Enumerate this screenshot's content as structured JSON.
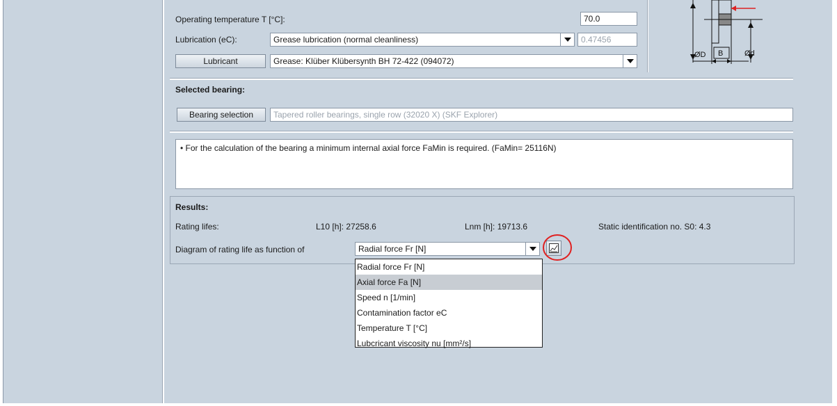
{
  "params": {
    "operating_temperature_label": "Operating temperature T [°C]:",
    "operating_temperature_value": "70.0",
    "lubrication_label": "Lubrication (eC):",
    "lubrication_value": "Grease lubrication (normal cleanliness)",
    "lubrication_ec_value": "0.47456",
    "lubricant_button": "Lubricant",
    "lubricant_value": "Grease: Klüber Klübersynth BH 72-422 (094072)"
  },
  "diagram_labels": {
    "outer_diameter": "ØD",
    "width": "B",
    "inner_diameter": "Ød",
    "force": "Fa"
  },
  "selected_bearing": {
    "heading": "Selected bearing:",
    "button": "Bearing selection",
    "value": "Tapered roller bearings, single row (32020 X) (SKF Explorer)"
  },
  "messages": {
    "text": "• For the calculation of the bearing a minimum internal axial force FaMin is required. (FaMin= 25116N)"
  },
  "results": {
    "heading": "Results:",
    "rating_lifes_label": "Rating lifes:",
    "l10": "L10 [h]:  27258.6",
    "lnm": "Lnm [h]:  19713.6",
    "s0": "Static identification no. S0:  4.3",
    "diagram_label": "Diagram of rating life as function of",
    "diagram_selected": "Radial force Fr [N]",
    "diagram_options": [
      "Radial force Fr [N]",
      "Axial force Fa [N]",
      "Speed n [1/min]",
      "Contamination factor eC",
      "Temperature T [°C]",
      "Lubcricant viscosity nu [mm²/s]"
    ],
    "highlighted_option_index": 1
  },
  "icons": {
    "chart_button_icon": "chart-icon",
    "annotation_circle_color": "#e02020"
  }
}
